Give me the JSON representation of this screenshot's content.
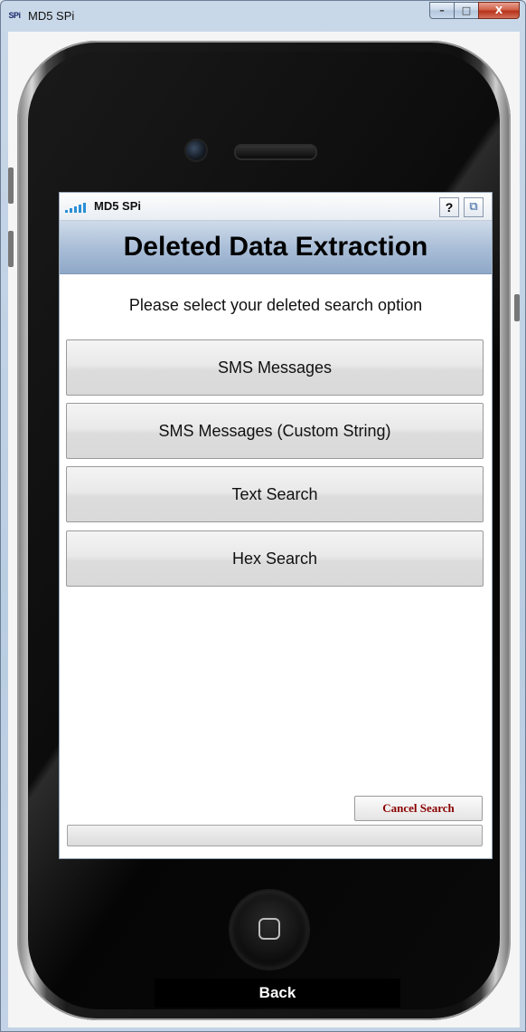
{
  "window": {
    "app_icon_text": "SPi",
    "title": "MD5 SPi",
    "minimize_label": "–",
    "maximize_label": "□",
    "close_label": "X"
  },
  "app": {
    "title": "MD5 SPi",
    "help_label": "?",
    "restore_label": "⧉",
    "header": "Deleted Data Extraction",
    "prompt": "Please select your deleted search option",
    "options": [
      "SMS Messages",
      "SMS Messages (Custom String)",
      "Text Search",
      "Hex Search"
    ],
    "cancel_label": "Cancel Search",
    "progress": 0
  },
  "device": {
    "back_label": "Back"
  },
  "colors": {
    "header_bg": "#a7bcd6",
    "cancel_text": "#8b0000",
    "signal_bars": "#2b8fd6"
  },
  "icons": {
    "app_icon": "spi-logo-icon",
    "signal": "signal-bars-icon",
    "help": "help-icon",
    "restore": "restore-window-icon",
    "home": "home-square-icon"
  }
}
